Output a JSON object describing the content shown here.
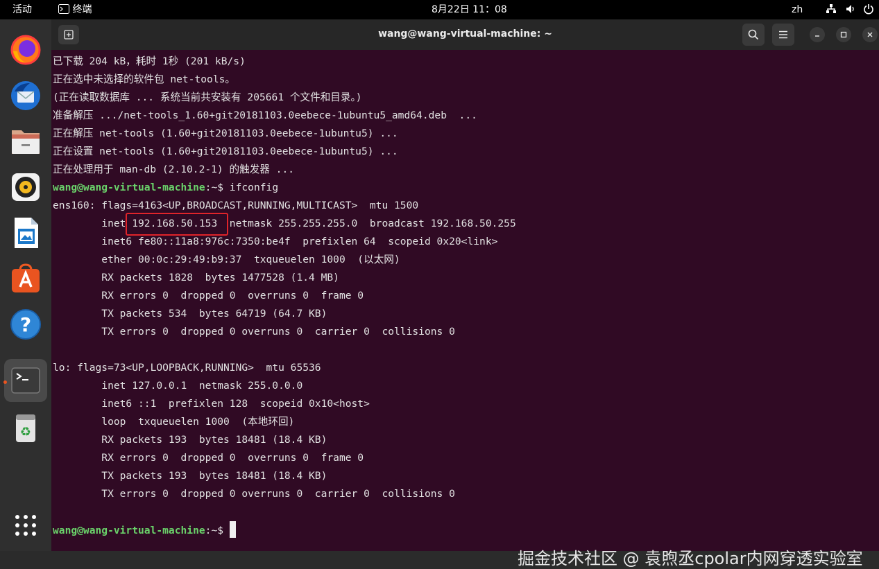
{
  "topbar": {
    "activities": "活动",
    "app_name": "终端",
    "clock": "8月22日  11：08",
    "lang": "zh"
  },
  "dock": {
    "apps": [
      "firefox-icon",
      "thunderbird-icon",
      "files-icon",
      "rhythmbox-icon",
      "writer-icon",
      "app-center-icon",
      "help-icon",
      "terminal-icon",
      "trash-icon"
    ]
  },
  "window": {
    "title": "wang@wang-virtual-machine: ~"
  },
  "terminal": {
    "lines": [
      {
        "text": "已下载 204 kB，耗时 1秒 (201 kB/s)"
      },
      {
        "text": "正在选中未选择的软件包 net-tools。"
      },
      {
        "text": "(正在读取数据库 ... 系统当前共安装有 205661 个文件和目录。)"
      },
      {
        "text": "准备解压 .../net-tools_1.60+git20181103.0eebece-1ubuntu5_amd64.deb  ..."
      },
      {
        "text": "正在解压 net-tools (1.60+git20181103.0eebece-1ubuntu5) ..."
      },
      {
        "text": "正在设置 net-tools (1.60+git20181103.0eebece-1ubuntu5) ..."
      },
      {
        "text": "正在处理用于 man-db (2.10.2-1) 的触发器 ..."
      },
      {
        "prompt": "wang@wang-virtual-machine",
        "path": ":~$ ",
        "text": "ifconfig"
      },
      {
        "text": "ens160: flags=4163<UP,BROADCAST,RUNNING,MULTICAST>  mtu 1500"
      },
      {
        "text": "        inet 192.168.50.153  netmask 255.255.255.0  broadcast 192.168.50.255"
      },
      {
        "text": "        inet6 fe80::11a8:976c:7350:be4f  prefixlen 64  scopeid 0x20<link>"
      },
      {
        "text": "        ether 00:0c:29:49:b9:37  txqueuelen 1000  (以太网)"
      },
      {
        "text": "        RX packets 1828  bytes 1477528 (1.4 MB)"
      },
      {
        "text": "        RX errors 0  dropped 0  overruns 0  frame 0"
      },
      {
        "text": "        TX packets 534  bytes 64719 (64.7 KB)"
      },
      {
        "text": "        TX errors 0  dropped 0 overruns 0  carrier 0  collisions 0"
      },
      {
        "text": ""
      },
      {
        "text": "lo: flags=73<UP,LOOPBACK,RUNNING>  mtu 65536"
      },
      {
        "text": "        inet 127.0.0.1  netmask 255.0.0.0"
      },
      {
        "text": "        inet6 ::1  prefixlen 128  scopeid 0x10<host>"
      },
      {
        "text": "        loop  txqueuelen 1000  (本地环回)"
      },
      {
        "text": "        RX packets 193  bytes 18481 (18.4 KB)"
      },
      {
        "text": "        RX errors 0  dropped 0  overruns 0  frame 0"
      },
      {
        "text": "        TX packets 193  bytes 18481 (18.4 KB)"
      },
      {
        "text": "        TX errors 0  dropped 0 overruns 0  carrier 0  collisions 0"
      },
      {
        "text": ""
      },
      {
        "prompt": "wang@wang-virtual-machine",
        "path": ":~$ ",
        "text": ""
      }
    ]
  },
  "watermark": "掘金技术社区 @ 袁煦丞cpolar内网穿透实验室",
  "colors": {
    "terminal_bg": "#300a24",
    "prompt": "#6ad26a",
    "highlight": "#e0242a"
  }
}
